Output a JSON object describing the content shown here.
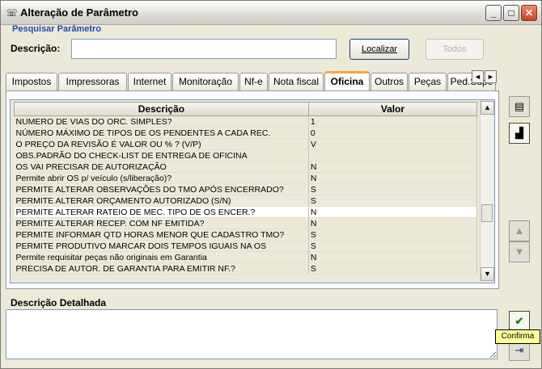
{
  "window": {
    "title": "Alteração de Parâmetro",
    "minimize": "_",
    "maximize": "□",
    "close": "✕"
  },
  "search": {
    "group_title": "Pesquisar Parâmetro",
    "label": "Descrição:",
    "value": "",
    "find_button": "Localizar",
    "all_button": "Todos"
  },
  "tabs": [
    "Impostos",
    "Impressoras",
    "Internet",
    "Monitoração",
    "Nf-e",
    "Nota fiscal",
    "Oficina",
    "Outros",
    "Peças",
    "Ped.Supe"
  ],
  "active_tab": "Oficina",
  "tab_scroll": {
    "left": "◄",
    "right": "►"
  },
  "table": {
    "headers": [
      "Descrição",
      "Valor"
    ],
    "rows": [
      [
        "NUMERO DE VIAS DO ORC. SIMPLES?",
        "1"
      ],
      [
        "NÚMERO MÁXIMO DE TIPOS DE OS PENDENTES A CADA REC.",
        "0"
      ],
      [
        "O PREÇO DA REVISÃO É VALOR OU % ? (V/P)",
        "V"
      ],
      [
        "OBS.PADRÃO DO CHECK-LIST DE ENTREGA DE OFICINA",
        ""
      ],
      [
        "OS VAI PRECISAR DE AUTORIZAÇÃO",
        "N"
      ],
      [
        "Permite abrir OS p/ veículo (s/liberação)?",
        "N"
      ],
      [
        "PERMITE ALTERAR OBSERVAÇÕES DO TMO APÓS ENCERRADO?",
        "S"
      ],
      [
        "PERMITE ALTERAR ORÇAMENTO AUTORIZADO (S/N)",
        "S"
      ],
      [
        "PERMITE ALTERAR RATEIO DE MEC. TIPO DE OS ENCER.?",
        "N"
      ],
      [
        "PERMITE ALTERAR RECEP. COM NF EMITIDA?",
        "N"
      ],
      [
        "PERMITE INFORMAR QTD HORAS MENOR QUE CADASTRO TMO?",
        "S"
      ],
      [
        "PERMITE PRODUTIVO MARCAR DOIS TEMPOS IGUAIS NA OS",
        "S"
      ],
      [
        "Permite requisitar peças não originais em Garantia",
        "N"
      ],
      [
        "PRECISA DE AUTOR. DE GARANTIA PARA EMITIR NF.?",
        "S"
      ]
    ]
  },
  "scroll": {
    "up": "▲",
    "down": "▼"
  },
  "detail": {
    "label": "Descrição Detalhada",
    "value": ""
  },
  "tooltip": "Confirma",
  "icons": {
    "window": "phone-icon",
    "grid_view": "grid-view-icon",
    "chart": "chart-icon",
    "move_up": "arrow-up-icon",
    "move_down": "arrow-down-icon",
    "confirm": "check-icon",
    "cancel": "exit-icon"
  },
  "colors": {
    "accent": "#2346b0",
    "active_tab": "#f5a742",
    "tooltip": "#ffff9c"
  }
}
